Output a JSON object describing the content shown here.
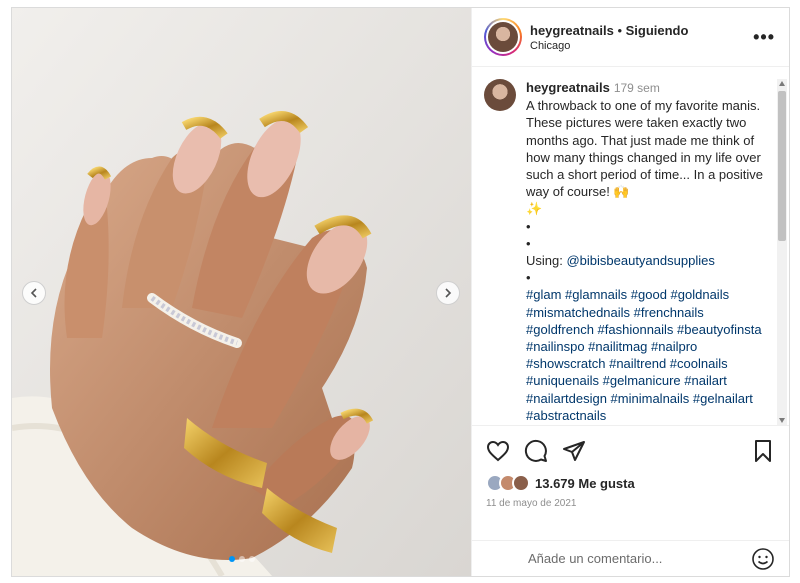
{
  "header": {
    "username": "heygreatnails",
    "separator": " • ",
    "follow_status": "Siguiendo",
    "location": "Chicago",
    "more_label": "•••"
  },
  "caption": {
    "username": "heygreatnails",
    "time": "179 sem",
    "text": "A throwback to one of my favorite manis. These pictures were taken exactly two months ago. That just made me think of how many things changed in my life over such a short period of time... In a positive way of course! 🙌",
    "sparkles": "✨",
    "bullet1": "•",
    "bullet2": "•",
    "using_label": "Using: ",
    "mention": "@bibisbeautyandsupplies",
    "bullet3": "•",
    "hashtags": "#glam #glamnails #good #goldnails #mismatchednails #frenchnails #goldfrench #fashionnails #beautyofinsta #nailinspo #nailitmag #nailpro #showscratch #nailtrend #coolnails #uniquenails #gelmanicure #nailart #nailartdesign #minimalnails #gelnailart #abstractnails"
  },
  "actions": {
    "like_icon": "heart-icon",
    "comment_icon": "comment-icon",
    "share_icon": "paper-plane-icon",
    "save_icon": "bookmark-icon"
  },
  "likes": {
    "count_text": "13.679 Me gusta"
  },
  "date": "11 de mayo de 2021",
  "comment_input": {
    "placeholder": "Añade un comentario..."
  },
  "carousel": {
    "slide_count": 3,
    "active_index": 0
  },
  "colors": {
    "link": "#00376b",
    "accent": "#0095f6",
    "muted": "#8e8e8e"
  }
}
